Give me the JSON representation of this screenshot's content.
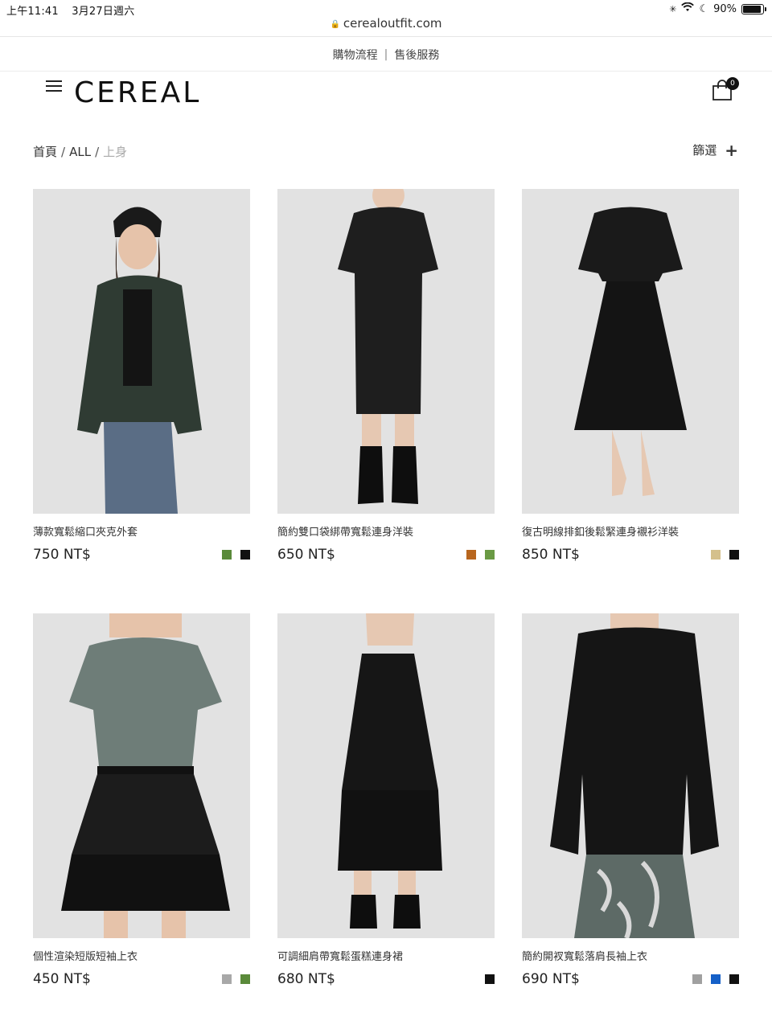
{
  "status_bar": {
    "time": "上午11:41",
    "date": "3月27日週六",
    "battery": "90%",
    "battery_level": 0.9
  },
  "url": "cerealoutfit.com",
  "top_links": [
    {
      "label": "購物流程"
    },
    {
      "label": "售後服務"
    }
  ],
  "header": {
    "logo": "CEREAL",
    "cart_count": "0"
  },
  "breadcrumb": {
    "home": "首頁",
    "all": "ALL",
    "current": "上身"
  },
  "filter": {
    "label": "篩選"
  },
  "products": [
    {
      "name": "薄款寬鬆縮口夾克外套",
      "price": "750 NT$",
      "swatches": [
        "#5a8a3a",
        "#111111"
      ]
    },
    {
      "name": "簡約雙口袋綁帶寬鬆連身洋裝",
      "price": "650 NT$",
      "swatches": [
        "#b8661e",
        "#6a9a44"
      ]
    },
    {
      "name": "復古明線排釦後鬆緊連身襯衫洋裝",
      "price": "850 NT$",
      "swatches": [
        "#d4c08c",
        "#111111"
      ]
    },
    {
      "name": "個性渲染短版短袖上衣",
      "price": "450 NT$",
      "swatches": [
        "#a8a8a8",
        "#5a8a3a"
      ]
    },
    {
      "name": "可調細肩帶寬鬆蛋糕連身裙",
      "price": "680 NT$",
      "swatches": [
        "#111111"
      ]
    },
    {
      "name": "簡約開衩寬鬆落肩長袖上衣",
      "price": "690 NT$",
      "swatches": [
        "#a0a0a0",
        "#1560c8",
        "#111111"
      ]
    }
  ]
}
